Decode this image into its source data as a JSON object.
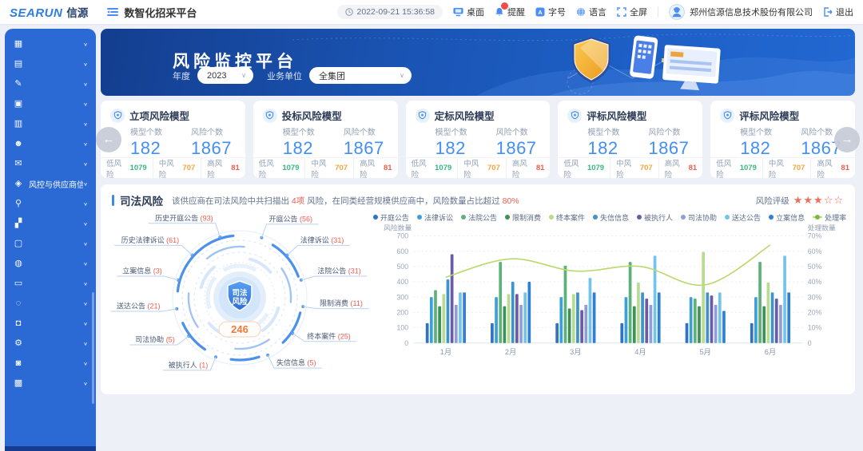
{
  "header": {
    "logo": {
      "sea": "SEA",
      "run": "RUN",
      "cn": "信源"
    },
    "app_title": "数智化招采平台",
    "time": "2022-09-21 15:36:58",
    "tools": [
      {
        "id": "desktop",
        "label": "桌面"
      },
      {
        "id": "notifications",
        "label": "提醒"
      },
      {
        "id": "font-size",
        "label": "字号"
      },
      {
        "id": "language",
        "label": "语言"
      },
      {
        "id": "fullscreen",
        "label": "全屏"
      }
    ],
    "company": "郑州信源信息技术股份有限公司",
    "logout_label": "退出"
  },
  "sidebar": {
    "items": [
      {
        "icon": "grid",
        "label": "",
        "active": false
      },
      {
        "icon": "calendar",
        "label": "",
        "active": false
      },
      {
        "icon": "edit",
        "label": "",
        "active": false
      },
      {
        "icon": "briefcase",
        "label": "",
        "active": false
      },
      {
        "icon": "card",
        "label": "",
        "active": false
      },
      {
        "icon": "user",
        "label": "",
        "active": false
      },
      {
        "icon": "doc",
        "label": "",
        "active": false
      },
      {
        "icon": "shield",
        "label": "风控与供应商信用",
        "active": true
      },
      {
        "icon": "search",
        "label": "",
        "active": false
      },
      {
        "icon": "chart",
        "label": "",
        "active": false
      },
      {
        "icon": "archive",
        "label": "",
        "active": false
      },
      {
        "icon": "package",
        "label": "",
        "active": false
      },
      {
        "icon": "monitor",
        "label": "",
        "active": false
      },
      {
        "icon": "circle",
        "label": "",
        "active": false
      },
      {
        "icon": "lock",
        "label": "",
        "active": false
      },
      {
        "icon": "gear",
        "label": "",
        "active": false
      },
      {
        "icon": "bag",
        "label": "",
        "active": false
      },
      {
        "icon": "journal",
        "label": "",
        "active": false
      }
    ]
  },
  "banner": {
    "title": "风险监控平台",
    "year_label": "年度",
    "year_value": "2023",
    "unit_label": "业务单位",
    "unit_value": "全集团"
  },
  "model_cards": {
    "stat_labels": {
      "model": "模型个数",
      "risk": "风险个数"
    },
    "footer_labels": {
      "low": "低风险",
      "mid": "中风险",
      "high": "高风险"
    },
    "status_colors": {
      "low": "#35b87f",
      "mid": "#f5a63b",
      "high": "#f25c4f"
    },
    "cards": [
      {
        "title": "立项风险模型",
        "model_count": "182",
        "risk_count": "1867",
        "low": "1079",
        "mid": "707",
        "high": "81"
      },
      {
        "title": "投标风险模型",
        "model_count": "182",
        "risk_count": "1867",
        "low": "1079",
        "mid": "707",
        "high": "81"
      },
      {
        "title": "定标风险模型",
        "model_count": "182",
        "risk_count": "1867",
        "low": "1079",
        "mid": "707",
        "high": "81"
      },
      {
        "title": "评标风险模型",
        "model_count": "182",
        "risk_count": "1867",
        "low": "1079",
        "mid": "707",
        "high": "81"
      },
      {
        "title": "评标风险模型",
        "model_count": "182",
        "risk_count": "1867",
        "low": "1079",
        "mid": "707",
        "high": "81"
      }
    ]
  },
  "judicial": {
    "section_title": "司法风险",
    "desc_part1": "该供应商在司法风险中共扫描出 ",
    "desc_hl1": "4项",
    "desc_part2": " 风险，在同类经营规模供应商中，风险数量占比超过 ",
    "desc_hl2": "80%",
    "rating_label": "风险评级",
    "stars_filled": 3,
    "stars_total": 5,
    "radial": {
      "center_line1": "司法",
      "center_line2": "风险",
      "total": "246",
      "items": [
        {
          "label": "开庭公告",
          "value": 56
        },
        {
          "label": "法律诉讼",
          "value": 31
        },
        {
          "label": "法院公告",
          "value": 31
        },
        {
          "label": "限制消费",
          "value": 11
        },
        {
          "label": "终本案件",
          "value": 25
        },
        {
          "label": "失信信息",
          "value": 5
        },
        {
          "label": "被执行人",
          "value": 1
        },
        {
          "label": "司法协助",
          "value": 5
        },
        {
          "label": "送达公告",
          "value": 21
        },
        {
          "label": "立案信息",
          "value": 3
        },
        {
          "label": "历史法律诉讼",
          "value": 61
        },
        {
          "label": "历史开庭公告",
          "value": 93
        }
      ]
    }
  },
  "chart_data": {
    "type": "bar",
    "categories": [
      "1月",
      "2月",
      "3月",
      "4月",
      "5月",
      "6月"
    ],
    "y_left": {
      "title": "风险数量",
      "min": 0,
      "max": 700,
      "step": 100
    },
    "y_right": {
      "title": "处理数量",
      "min": 0,
      "max": 70,
      "step": 10,
      "unit": "%"
    },
    "legend_position": "top",
    "grid": "dotted-horizontal",
    "series": [
      {
        "name": "开庭公告",
        "color": "#3272c2",
        "values": [
          130,
          130,
          130,
          130,
          130,
          130
        ]
      },
      {
        "name": "法律诉讼",
        "color": "#3c9fd8",
        "values": [
          300,
          300,
          300,
          300,
          300,
          300
        ]
      },
      {
        "name": "法院公告",
        "color": "#5cb27a",
        "values": [
          345,
          530,
          505,
          530,
          290,
          530
        ]
      },
      {
        "name": "限制消费",
        "color": "#3f9257",
        "values": [
          240,
          240,
          225,
          240,
          240,
          240
        ]
      },
      {
        "name": "终本案件",
        "color": "#b8dc8f",
        "values": [
          320,
          320,
          320,
          395,
          595,
          395
        ]
      },
      {
        "name": "失信信息",
        "color": "#3e93c9",
        "values": [
          415,
          400,
          330,
          330,
          330,
          330
        ]
      },
      {
        "name": "被执行人",
        "color": "#6a5aa8",
        "values": [
          580,
          320,
          215,
          290,
          310,
          290
        ]
      },
      {
        "name": "司法协助",
        "color": "#8e9ed8",
        "values": [
          250,
          250,
          250,
          250,
          250,
          250
        ]
      },
      {
        "name": "送达公告",
        "color": "#74c3ea",
        "values": [
          330,
          330,
          425,
          570,
          330,
          570
        ]
      },
      {
        "name": "立案信息",
        "color": "#2f7fd6",
        "values": [
          330,
          400,
          330,
          330,
          210,
          330
        ]
      }
    ],
    "line": {
      "name": "处理率",
      "color": "#bcd96e",
      "marker_color": "#7cb93e",
      "values": [
        43,
        55,
        47,
        50,
        38,
        64
      ]
    }
  }
}
